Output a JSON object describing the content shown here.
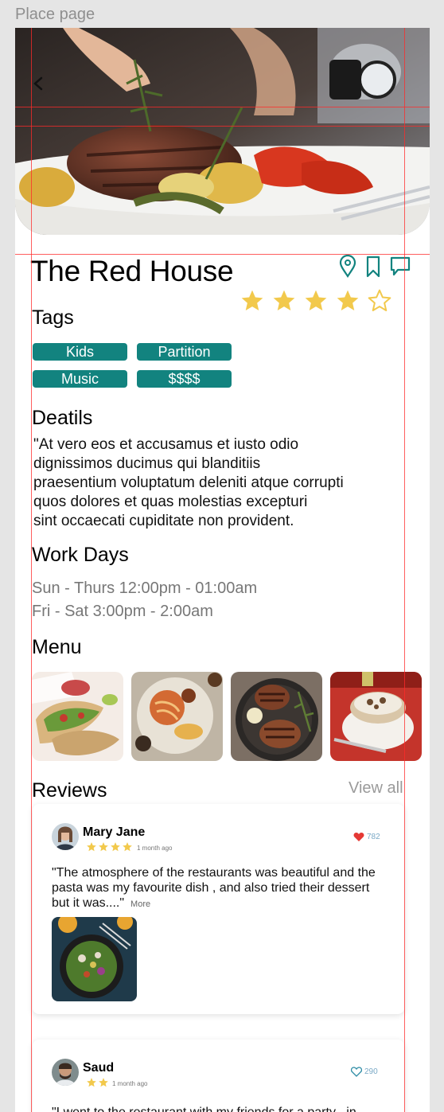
{
  "frame_label": "Place page",
  "place": {
    "name": "The Red House",
    "rating": 4,
    "rating_max": 5
  },
  "icons": {
    "back": "chevron-left-icon",
    "location": "map-pin-icon",
    "bookmark": "bookmark-icon",
    "comment": "comment-icon",
    "star": "star-icon",
    "heart": "heart-icon"
  },
  "colors": {
    "accent": "#12837f",
    "star": "#f2c94c",
    "heart_filled": "#e53935",
    "heart_outline": "#2f8da6"
  },
  "tags": {
    "title": "Tags",
    "items": [
      "Kids",
      "Partition",
      "Music",
      "$$$$"
    ]
  },
  "details": {
    "title": "Deatils",
    "text": "\"At vero eos et accusamus et iusto odio\ndignissimos ducimus qui blanditiis\npraesentium voluptatum deleniti atque corrupti\nquos dolores et quas molestias excepturi\n sint occaecati cupiditate non provident."
  },
  "work_days": {
    "title": "Work Days",
    "lines": [
      "Sun - Thurs 12:00pm - 01:00am",
      "Fri - Sat 3:00pm - 2:00am"
    ]
  },
  "menu": {
    "title": "Menu",
    "items": [
      "tacos-dish",
      "pasta-dish",
      "grilled-steak-dish",
      "dessert-bowl-dish"
    ]
  },
  "reviews": {
    "title": "Reviews",
    "view_all": "View all",
    "items": [
      {
        "name": "Mary Jane",
        "stars": 4,
        "time": "1 month ago",
        "likes": "782",
        "liked": true,
        "text": "\"The atmosphere of the restaurants was beautiful and the pasta was my favourite dish , and also tried their dessert but it was....\"",
        "more": "More",
        "has_photo": true
      },
      {
        "name": "Saud",
        "stars": 2,
        "time": "1 month ago",
        "likes": "290",
        "liked": false,
        "text": "\"I went to the restaurant with my friends for a party , in"
      }
    ]
  }
}
